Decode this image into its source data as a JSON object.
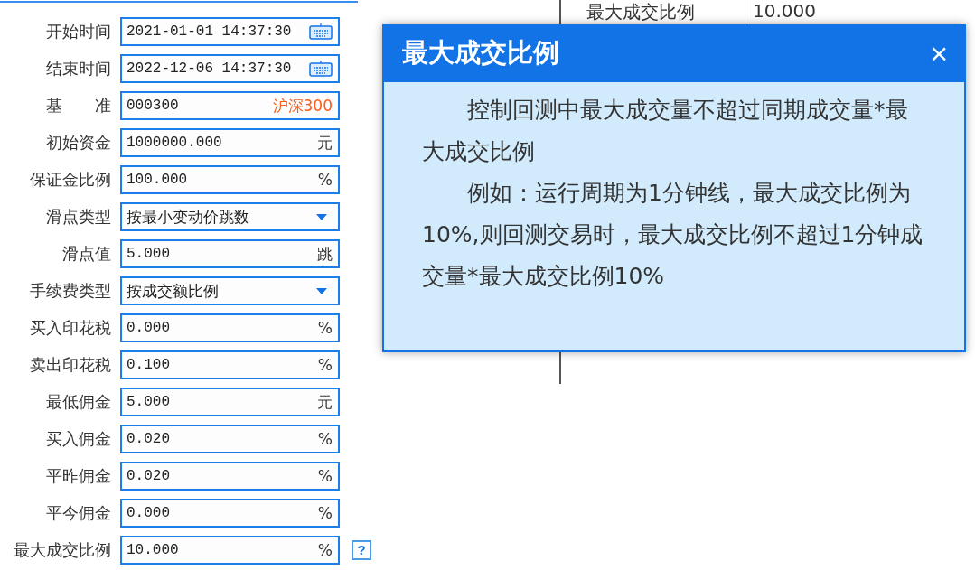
{
  "form": {
    "rows": [
      {
        "label": "开始时间",
        "value": "2021-01-01 14:37:30",
        "kind": "datetime"
      },
      {
        "label": "结束时间",
        "value": "2022-12-06 14:37:30",
        "kind": "datetime"
      },
      {
        "label": "基　　准",
        "value": "000300",
        "kind": "code",
        "suffix": "沪深300"
      },
      {
        "label": "初始资金",
        "value": "1000000.000",
        "kind": "text",
        "suffix": "元"
      },
      {
        "label": "保证金比例",
        "value": "100.000",
        "kind": "text",
        "suffix": "%"
      },
      {
        "label": "滑点类型",
        "value": "按最小变动价跳数",
        "kind": "select"
      },
      {
        "label": "滑点值",
        "value": "5.000",
        "kind": "text",
        "suffix": "跳"
      },
      {
        "label": "手续费类型",
        "value": "按成交额比例",
        "kind": "select"
      },
      {
        "label": "买入印花税",
        "value": "0.000",
        "kind": "text",
        "suffix": "%"
      },
      {
        "label": "卖出印花税",
        "value": "0.100",
        "kind": "text",
        "suffix": "%"
      },
      {
        "label": "最低佣金",
        "value": "5.000",
        "kind": "text",
        "suffix": "元"
      },
      {
        "label": "买入佣金",
        "value": "0.020",
        "kind": "text",
        "suffix": "%"
      },
      {
        "label": "平昨佣金",
        "value": "0.020",
        "kind": "text",
        "suffix": "%"
      },
      {
        "label": "平今佣金",
        "value": "0.000",
        "kind": "text",
        "suffix": "%"
      },
      {
        "label": "最大成交比例",
        "value": "10.000",
        "kind": "text",
        "suffix": "%",
        "help": "?"
      }
    ]
  },
  "background_table": {
    "label": "最大成交比例",
    "value": "10.000"
  },
  "dialog": {
    "title": "最大成交比例",
    "close": "×",
    "paragraphs": [
      "控制回测中最大成交量不超过同期成交量*最大成交比例",
      "例如：运行周期为1分钟线，最大成交比例为10%,则回测交易时，最大成交比例不超过1分钟成交量*最大成交比例10%"
    ]
  }
}
